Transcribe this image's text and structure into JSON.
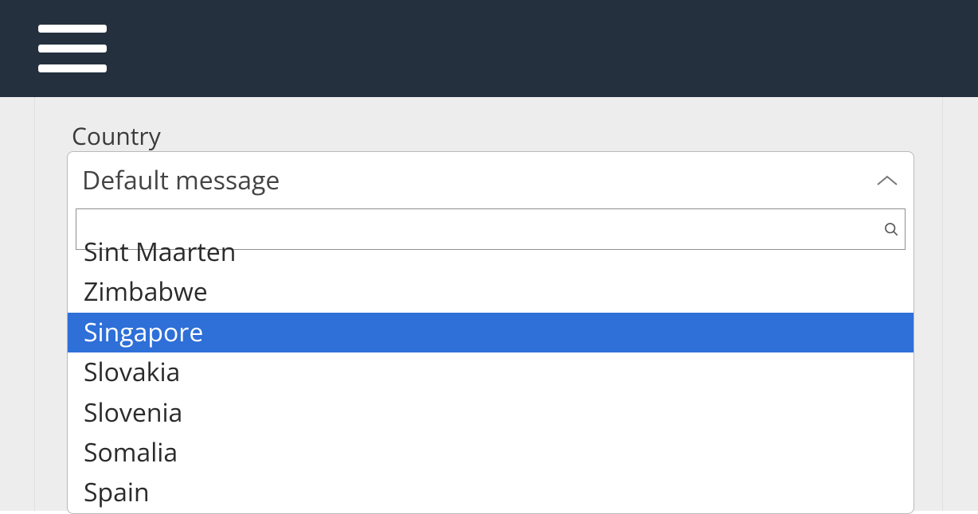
{
  "field": {
    "label": "Country"
  },
  "select": {
    "placeholder": "Default message",
    "search_value": "",
    "options": {
      "a": "Sint Maarten",
      "b": "Zimbabwe",
      "c": "Singapore",
      "d": "Slovakia",
      "e": "Slovenia",
      "f": "Somalia",
      "g": "Spain"
    },
    "highlighted": "Singapore"
  }
}
